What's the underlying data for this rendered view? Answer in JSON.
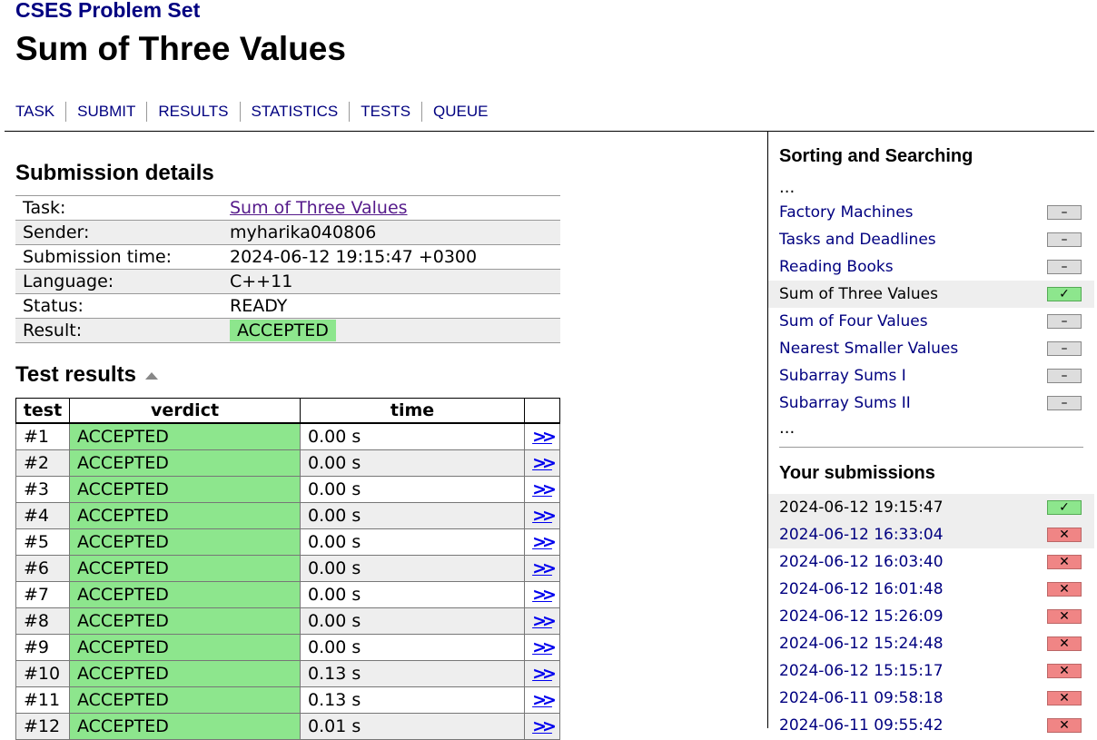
{
  "site": {
    "title": "CSES Problem Set"
  },
  "page": {
    "title": "Sum of Three Values"
  },
  "nav": [
    "TASK",
    "SUBMIT",
    "RESULTS",
    "STATISTICS",
    "TESTS",
    "QUEUE"
  ],
  "details": {
    "heading": "Submission details",
    "rows": [
      {
        "label": "Task:",
        "value": "Sum of Three Values"
      },
      {
        "label": "Sender:",
        "value": "myharika040806"
      },
      {
        "label": "Submission time:",
        "value": "2024-06-12 19:15:47 +0300"
      },
      {
        "label": "Language:",
        "value": "C++11"
      },
      {
        "label": "Status:",
        "value": "READY"
      },
      {
        "label": "Result:",
        "value": "ACCEPTED"
      }
    ]
  },
  "tests": {
    "heading": "Test results",
    "columns": [
      "test",
      "verdict",
      "time",
      ""
    ],
    "rows": [
      {
        "test": "#1",
        "verdict": "ACCEPTED",
        "time": "0.00 s"
      },
      {
        "test": "#2",
        "verdict": "ACCEPTED",
        "time": "0.00 s"
      },
      {
        "test": "#3",
        "verdict": "ACCEPTED",
        "time": "0.00 s"
      },
      {
        "test": "#4",
        "verdict": "ACCEPTED",
        "time": "0.00 s"
      },
      {
        "test": "#5",
        "verdict": "ACCEPTED",
        "time": "0.00 s"
      },
      {
        "test": "#6",
        "verdict": "ACCEPTED",
        "time": "0.00 s"
      },
      {
        "test": "#7",
        "verdict": "ACCEPTED",
        "time": "0.00 s"
      },
      {
        "test": "#8",
        "verdict": "ACCEPTED",
        "time": "0.00 s"
      },
      {
        "test": "#9",
        "verdict": "ACCEPTED",
        "time": "0.00 s"
      },
      {
        "test": "#10",
        "verdict": "ACCEPTED",
        "time": "0.13 s"
      },
      {
        "test": "#11",
        "verdict": "ACCEPTED",
        "time": "0.13 s"
      },
      {
        "test": "#12",
        "verdict": "ACCEPTED",
        "time": "0.01 s"
      }
    ]
  },
  "sidebar": {
    "heading": "Sorting and Searching",
    "ellipsis": "...",
    "problems": [
      {
        "name": "Factory Machines",
        "status": "none",
        "mark": "–"
      },
      {
        "name": "Tasks and Deadlines",
        "status": "none",
        "mark": "–"
      },
      {
        "name": "Reading Books",
        "status": "none",
        "mark": "–"
      },
      {
        "name": "Sum of Three Values",
        "status": "solved",
        "mark": "✓",
        "current": true
      },
      {
        "name": "Sum of Four Values",
        "status": "none",
        "mark": "–"
      },
      {
        "name": "Nearest Smaller Values",
        "status": "none",
        "mark": "–"
      },
      {
        "name": "Subarray Sums I",
        "status": "none",
        "mark": "–"
      },
      {
        "name": "Subarray Sums II",
        "status": "none",
        "mark": "–"
      }
    ],
    "submissions_heading": "Your submissions",
    "submissions": [
      {
        "time": "2024-06-12 19:15:47",
        "status": "accepted",
        "mark": "✓",
        "current": true
      },
      {
        "time": "2024-06-12 16:33:04",
        "status": "rejected",
        "mark": "✕",
        "hover": true
      },
      {
        "time": "2024-06-12 16:03:40",
        "status": "rejected",
        "mark": "✕"
      },
      {
        "time": "2024-06-12 16:01:48",
        "status": "rejected",
        "mark": "✕"
      },
      {
        "time": "2024-06-12 15:26:09",
        "status": "rejected",
        "mark": "✕"
      },
      {
        "time": "2024-06-12 15:24:48",
        "status": "rejected",
        "mark": "✕"
      },
      {
        "time": "2024-06-12 15:15:17",
        "status": "rejected",
        "mark": "✕"
      },
      {
        "time": "2024-06-11 09:58:18",
        "status": "rejected",
        "mark": "✕"
      },
      {
        "time": "2024-06-11 09:55:42",
        "status": "rejected",
        "mark": "✕"
      }
    ]
  },
  "colors": {
    "accepted": "#8de68d",
    "rejected": "#f08585",
    "link": "#000080",
    "neutral": "#dddddd"
  }
}
